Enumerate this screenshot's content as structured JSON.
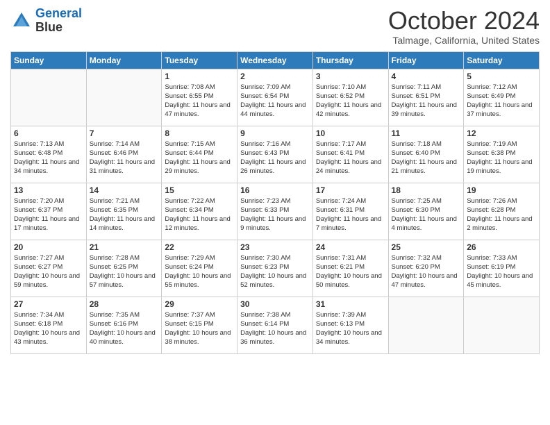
{
  "header": {
    "logo_line1": "General",
    "logo_line2": "Blue",
    "title": "October 2024",
    "subtitle": "Talmage, California, United States"
  },
  "days_of_week": [
    "Sunday",
    "Monday",
    "Tuesday",
    "Wednesday",
    "Thursday",
    "Friday",
    "Saturday"
  ],
  "weeks": [
    [
      {
        "day": "",
        "empty": true
      },
      {
        "day": "",
        "empty": true
      },
      {
        "day": "1",
        "sunrise": "Sunrise: 7:08 AM",
        "sunset": "Sunset: 6:55 PM",
        "daylight": "Daylight: 11 hours and 47 minutes."
      },
      {
        "day": "2",
        "sunrise": "Sunrise: 7:09 AM",
        "sunset": "Sunset: 6:54 PM",
        "daylight": "Daylight: 11 hours and 44 minutes."
      },
      {
        "day": "3",
        "sunrise": "Sunrise: 7:10 AM",
        "sunset": "Sunset: 6:52 PM",
        "daylight": "Daylight: 11 hours and 42 minutes."
      },
      {
        "day": "4",
        "sunrise": "Sunrise: 7:11 AM",
        "sunset": "Sunset: 6:51 PM",
        "daylight": "Daylight: 11 hours and 39 minutes."
      },
      {
        "day": "5",
        "sunrise": "Sunrise: 7:12 AM",
        "sunset": "Sunset: 6:49 PM",
        "daylight": "Daylight: 11 hours and 37 minutes."
      }
    ],
    [
      {
        "day": "6",
        "sunrise": "Sunrise: 7:13 AM",
        "sunset": "Sunset: 6:48 PM",
        "daylight": "Daylight: 11 hours and 34 minutes."
      },
      {
        "day": "7",
        "sunrise": "Sunrise: 7:14 AM",
        "sunset": "Sunset: 6:46 PM",
        "daylight": "Daylight: 11 hours and 31 minutes."
      },
      {
        "day": "8",
        "sunrise": "Sunrise: 7:15 AM",
        "sunset": "Sunset: 6:44 PM",
        "daylight": "Daylight: 11 hours and 29 minutes."
      },
      {
        "day": "9",
        "sunrise": "Sunrise: 7:16 AM",
        "sunset": "Sunset: 6:43 PM",
        "daylight": "Daylight: 11 hours and 26 minutes."
      },
      {
        "day": "10",
        "sunrise": "Sunrise: 7:17 AM",
        "sunset": "Sunset: 6:41 PM",
        "daylight": "Daylight: 11 hours and 24 minutes."
      },
      {
        "day": "11",
        "sunrise": "Sunrise: 7:18 AM",
        "sunset": "Sunset: 6:40 PM",
        "daylight": "Daylight: 11 hours and 21 minutes."
      },
      {
        "day": "12",
        "sunrise": "Sunrise: 7:19 AM",
        "sunset": "Sunset: 6:38 PM",
        "daylight": "Daylight: 11 hours and 19 minutes."
      }
    ],
    [
      {
        "day": "13",
        "sunrise": "Sunrise: 7:20 AM",
        "sunset": "Sunset: 6:37 PM",
        "daylight": "Daylight: 11 hours and 17 minutes."
      },
      {
        "day": "14",
        "sunrise": "Sunrise: 7:21 AM",
        "sunset": "Sunset: 6:35 PM",
        "daylight": "Daylight: 11 hours and 14 minutes."
      },
      {
        "day": "15",
        "sunrise": "Sunrise: 7:22 AM",
        "sunset": "Sunset: 6:34 PM",
        "daylight": "Daylight: 11 hours and 12 minutes."
      },
      {
        "day": "16",
        "sunrise": "Sunrise: 7:23 AM",
        "sunset": "Sunset: 6:33 PM",
        "daylight": "Daylight: 11 hours and 9 minutes."
      },
      {
        "day": "17",
        "sunrise": "Sunrise: 7:24 AM",
        "sunset": "Sunset: 6:31 PM",
        "daylight": "Daylight: 11 hours and 7 minutes."
      },
      {
        "day": "18",
        "sunrise": "Sunrise: 7:25 AM",
        "sunset": "Sunset: 6:30 PM",
        "daylight": "Daylight: 11 hours and 4 minutes."
      },
      {
        "day": "19",
        "sunrise": "Sunrise: 7:26 AM",
        "sunset": "Sunset: 6:28 PM",
        "daylight": "Daylight: 11 hours and 2 minutes."
      }
    ],
    [
      {
        "day": "20",
        "sunrise": "Sunrise: 7:27 AM",
        "sunset": "Sunset: 6:27 PM",
        "daylight": "Daylight: 10 hours and 59 minutes."
      },
      {
        "day": "21",
        "sunrise": "Sunrise: 7:28 AM",
        "sunset": "Sunset: 6:25 PM",
        "daylight": "Daylight: 10 hours and 57 minutes."
      },
      {
        "day": "22",
        "sunrise": "Sunrise: 7:29 AM",
        "sunset": "Sunset: 6:24 PM",
        "daylight": "Daylight: 10 hours and 55 minutes."
      },
      {
        "day": "23",
        "sunrise": "Sunrise: 7:30 AM",
        "sunset": "Sunset: 6:23 PM",
        "daylight": "Daylight: 10 hours and 52 minutes."
      },
      {
        "day": "24",
        "sunrise": "Sunrise: 7:31 AM",
        "sunset": "Sunset: 6:21 PM",
        "daylight": "Daylight: 10 hours and 50 minutes."
      },
      {
        "day": "25",
        "sunrise": "Sunrise: 7:32 AM",
        "sunset": "Sunset: 6:20 PM",
        "daylight": "Daylight: 10 hours and 47 minutes."
      },
      {
        "day": "26",
        "sunrise": "Sunrise: 7:33 AM",
        "sunset": "Sunset: 6:19 PM",
        "daylight": "Daylight: 10 hours and 45 minutes."
      }
    ],
    [
      {
        "day": "27",
        "sunrise": "Sunrise: 7:34 AM",
        "sunset": "Sunset: 6:18 PM",
        "daylight": "Daylight: 10 hours and 43 minutes."
      },
      {
        "day": "28",
        "sunrise": "Sunrise: 7:35 AM",
        "sunset": "Sunset: 6:16 PM",
        "daylight": "Daylight: 10 hours and 40 minutes."
      },
      {
        "day": "29",
        "sunrise": "Sunrise: 7:37 AM",
        "sunset": "Sunset: 6:15 PM",
        "daylight": "Daylight: 10 hours and 38 minutes."
      },
      {
        "day": "30",
        "sunrise": "Sunrise: 7:38 AM",
        "sunset": "Sunset: 6:14 PM",
        "daylight": "Daylight: 10 hours and 36 minutes."
      },
      {
        "day": "31",
        "sunrise": "Sunrise: 7:39 AM",
        "sunset": "Sunset: 6:13 PM",
        "daylight": "Daylight: 10 hours and 34 minutes."
      },
      {
        "day": "",
        "empty": true
      },
      {
        "day": "",
        "empty": true
      }
    ]
  ]
}
